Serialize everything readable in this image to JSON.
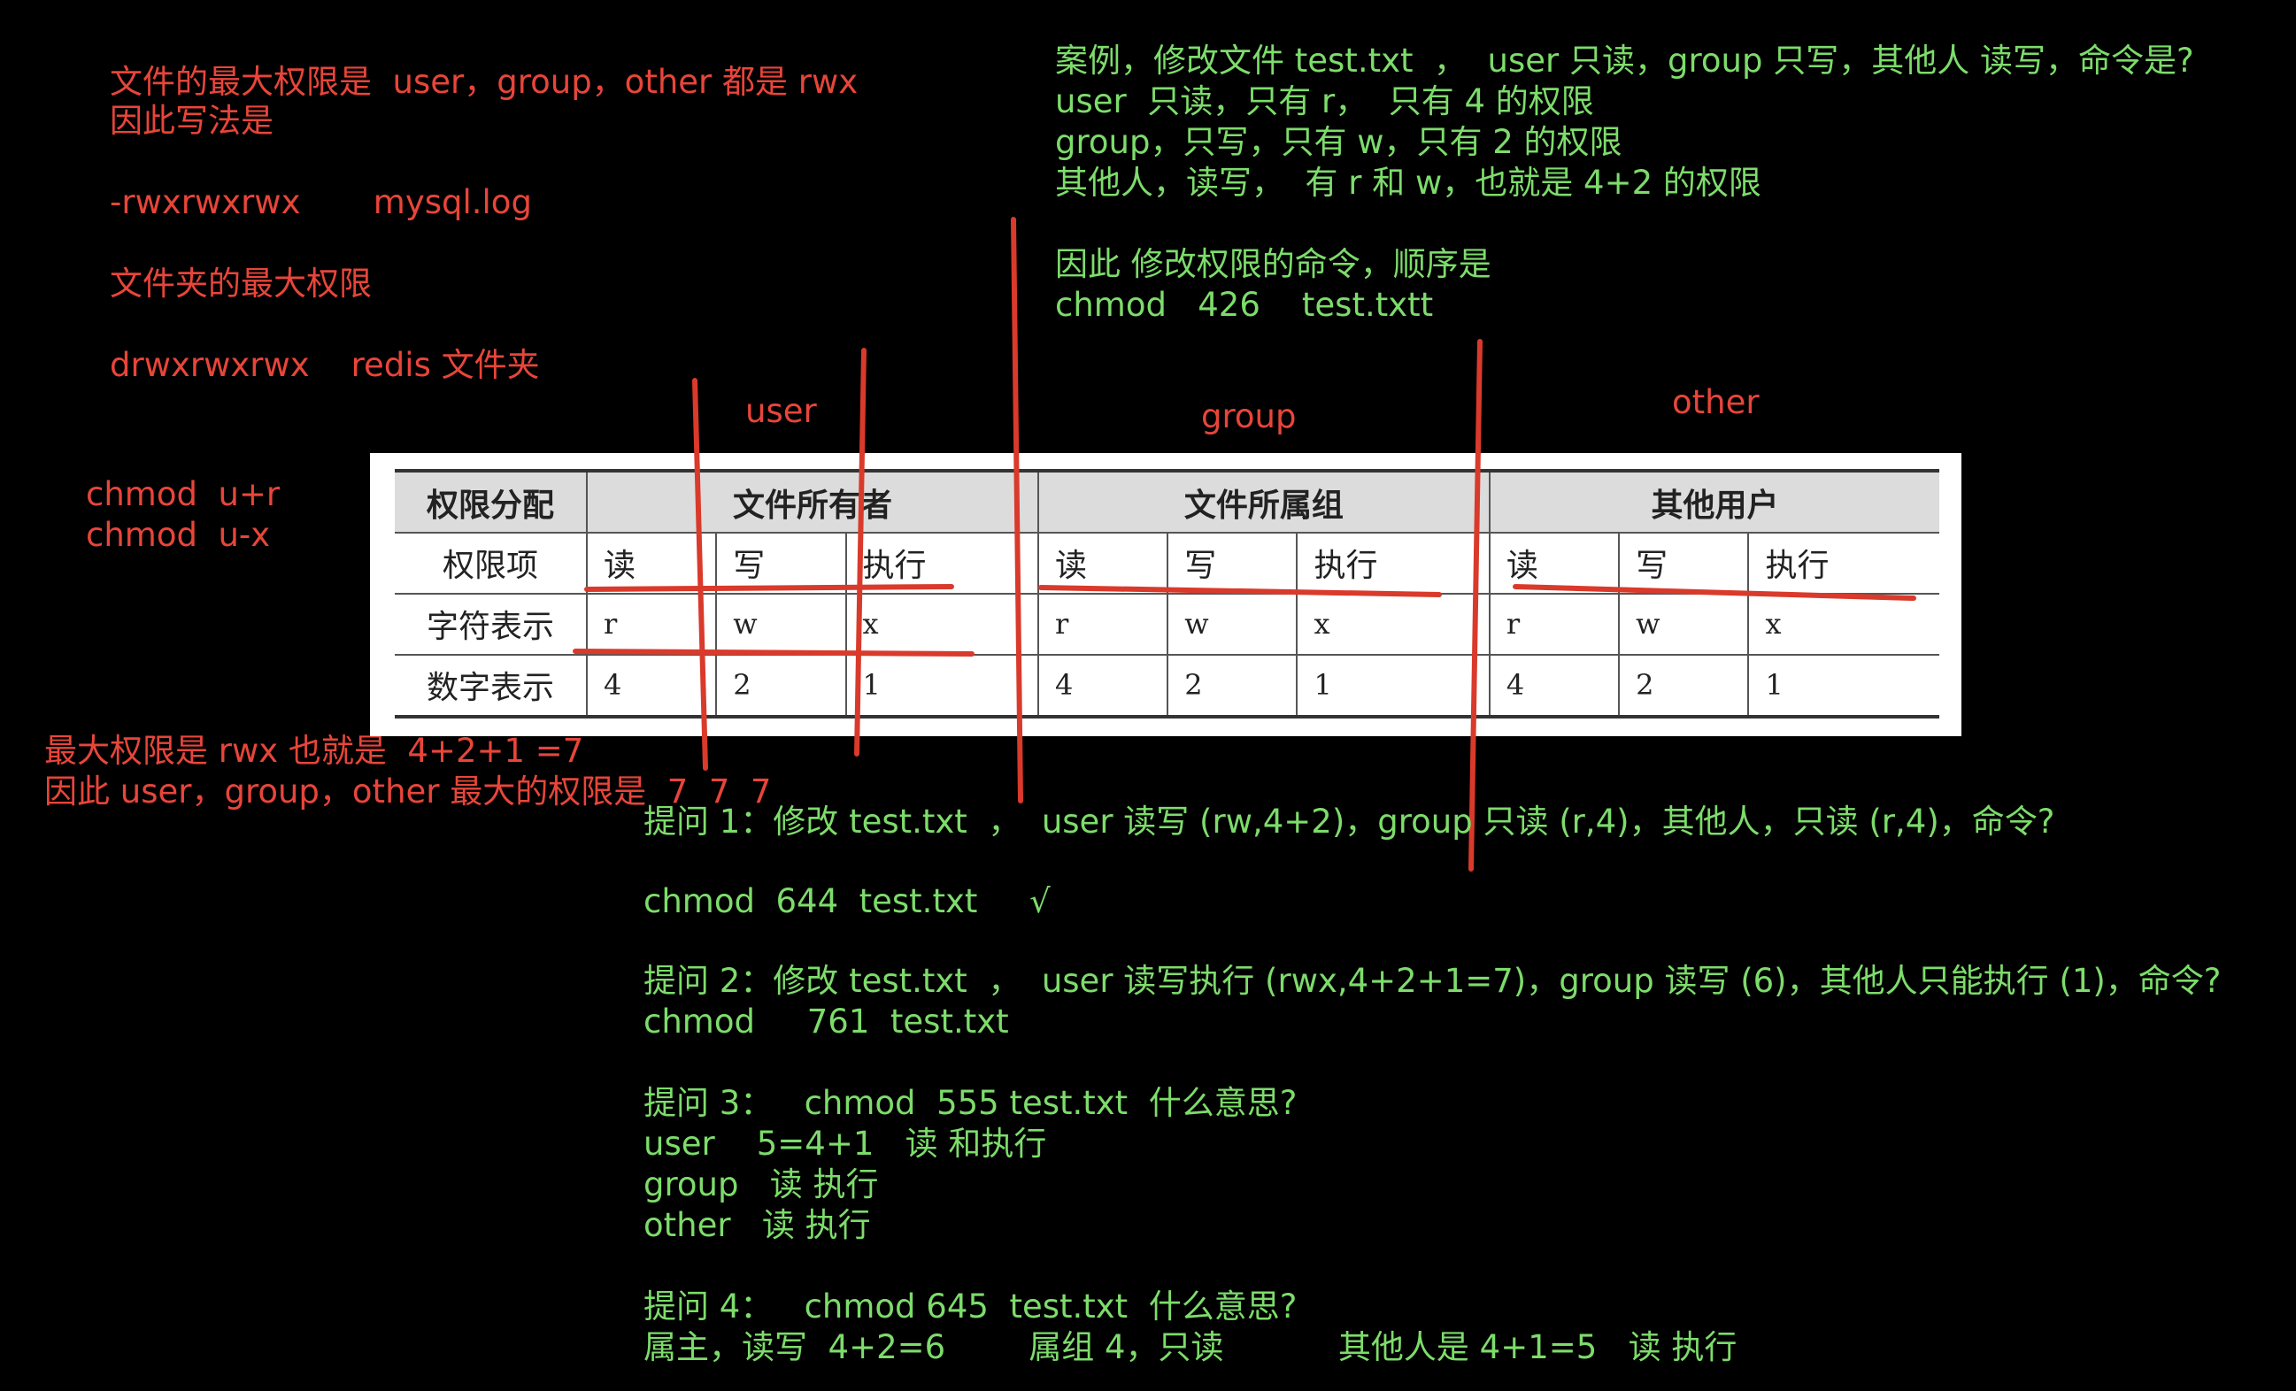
{
  "left_notes": {
    "line1": "文件的最大权限是  user，group，other 都是 rwx",
    "line2": "因此写法是",
    "file_example": "-rwxrwxrwx       mysql.log",
    "dir_heading": "文件夹的最大权限",
    "dir_example": "drwxrwxrwx    redis 文件夹",
    "chmod1": "chmod  u+r",
    "chmod2": "chmod  u-x",
    "max1": "最大权限是 rwx 也就是  4+2+1 =7",
    "max2": "因此 user，group，other 最大的权限是  7  7  7"
  },
  "case": {
    "line1": "案例，修改文件 test.txt  ，  user 只读，group 只写，其他人 读写，命令是?",
    "line2": "user  只读，只有 r，  只有 4 的权限",
    "line3": "group，只写，只有 w，只有 2 的权限",
    "line4": "其他人，读写，  有 r 和 w，也就是 4+2 的权限",
    "line5": "因此 修改权限的命令，顺序是",
    "line6": "chmod   426    test.txtt"
  },
  "column_labels": {
    "user": "user",
    "group": "group",
    "other": "other"
  },
  "table": {
    "header": [
      "权限分配",
      "文件所有者",
      "文件所属组",
      "其他用户"
    ],
    "row_items": [
      "权限项",
      "读",
      "写",
      "执行",
      "读",
      "写",
      "执行",
      "读",
      "写",
      "执行"
    ],
    "row_chars": [
      "字符表示",
      "r",
      "w",
      "x",
      "r",
      "w",
      "x",
      "r",
      "w",
      "x"
    ],
    "row_nums": [
      "数字表示",
      "4",
      "2",
      "1",
      "4",
      "2",
      "1",
      "4",
      "2",
      "1"
    ]
  },
  "questions": {
    "q1": "提问 1：修改 test.txt  ，  user 读写 (rw,4+2)，group 只读 (r,4)，其他人，只读 (r,4)，命令?",
    "a1": "chmod  644  test.txt     √",
    "q2": "提问 2：修改 test.txt  ，  user 读写执行 (rwx,4+2+1=7)，group 读写 (6)，其他人只能执行 (1)，命令?",
    "a2": "chmod     761  test.txt",
    "q3": "提问 3：   chmod  555 test.txt  什么意思?",
    "a3_user": "user    5=4+1   读 和执行",
    "a3_group": "group   读 执行",
    "a3_other": "other   读 执行",
    "q4": "提问 4：   chmod 645  test.txt  什么意思?",
    "a4": "属主，读写  4+2=6        属组 4，只读           其他人是 4+1=5   读 执行"
  },
  "colors": {
    "background": "#000000",
    "red_text": "#e8453a",
    "green_text": "#7ddc6b",
    "stroke": "#d93a2b"
  }
}
